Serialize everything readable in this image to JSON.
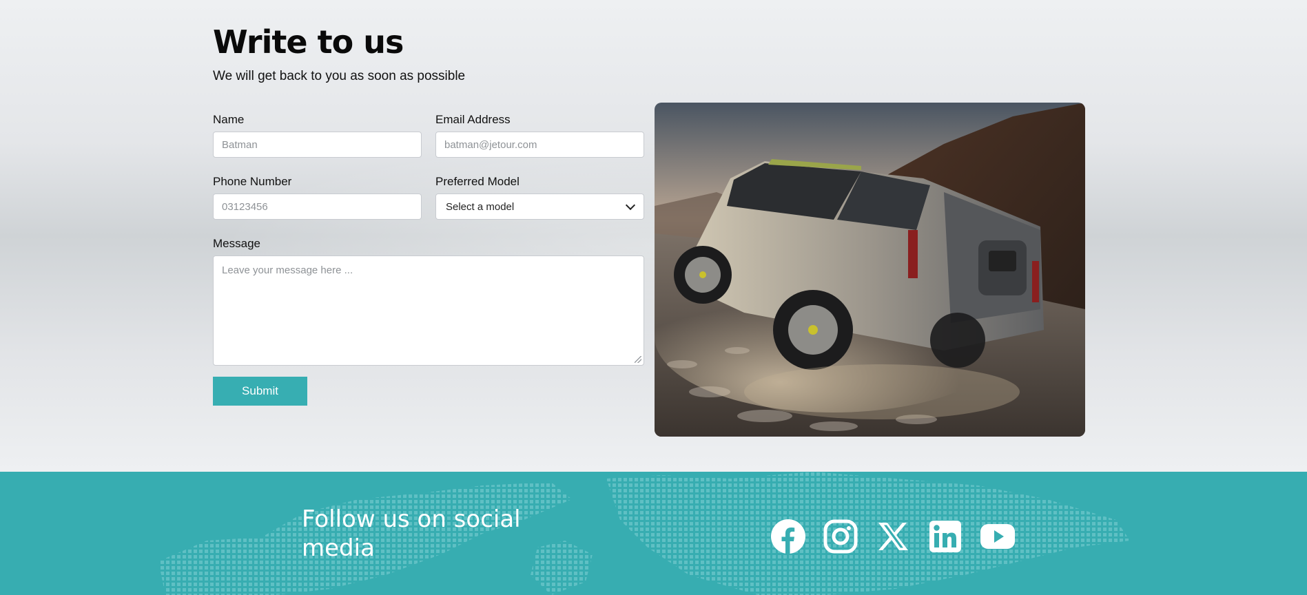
{
  "contact": {
    "title": "Write to us",
    "subtitle": "We will get back to you as soon as possible",
    "fields": {
      "name": {
        "label": "Name",
        "placeholder": "Batman"
      },
      "email": {
        "label": "Email Address",
        "placeholder": "batman@jetour.com"
      },
      "phone": {
        "label": "Phone Number",
        "placeholder": "03123456"
      },
      "model": {
        "label": "Preferred Model",
        "selected": "Select a model"
      },
      "message": {
        "label": "Message",
        "placeholder": "Leave your message here ..."
      }
    },
    "submit_label": "Submit"
  },
  "footer": {
    "title": "Follow us on social media",
    "social": [
      {
        "icon": "facebook-icon"
      },
      {
        "icon": "instagram-icon"
      },
      {
        "icon": "x-icon"
      },
      {
        "icon": "linkedin-icon"
      },
      {
        "icon": "youtube-icon"
      }
    ],
    "background_color": "#37adb1"
  },
  "colors": {
    "accent": "#37aeb2"
  }
}
